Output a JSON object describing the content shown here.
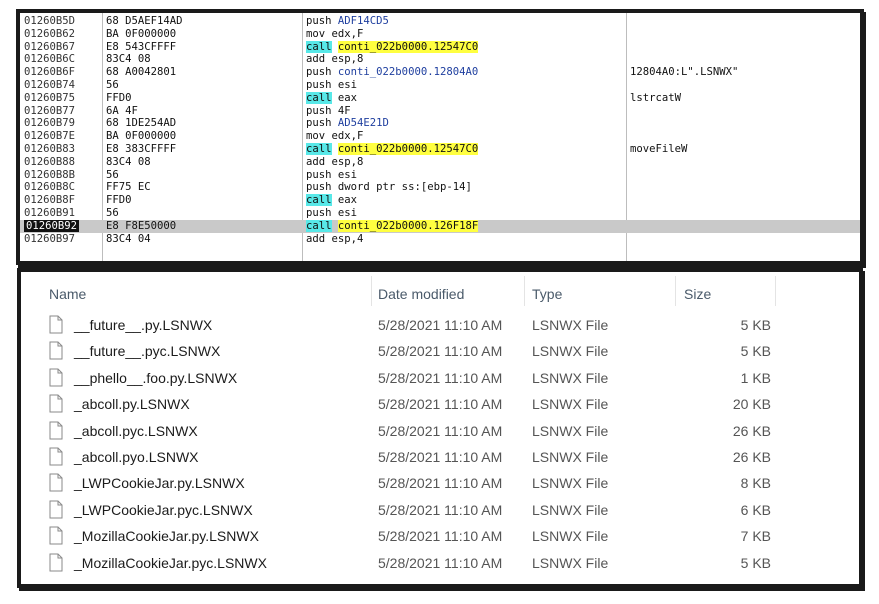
{
  "disassembly": {
    "rows": [
      {
        "addr": "01260B5D",
        "bytes": "68 D5AEF14AD",
        "mnem": "push",
        "op": "ADF14CD5",
        "cmt": ""
      },
      {
        "addr": "01260B62",
        "bytes": "BA 0F000000",
        "mnem": "mov",
        "op": "edx,F",
        "cmt": ""
      },
      {
        "addr": "01260B67",
        "bytes": "E8 543CFFFF",
        "mnem": "call",
        "op": "conti_022b0000.12547C0",
        "cmt": ""
      },
      {
        "addr": "01260B6C",
        "bytes": "83C4 08",
        "mnem": "add",
        "op": "esp,8",
        "cmt": ""
      },
      {
        "addr": "01260B6F",
        "bytes": "68 A0042801",
        "mnem": "push",
        "op": "conti_022b0000.12804A0",
        "cmt": "12804A0:L\".LSNWX\""
      },
      {
        "addr": "01260B74",
        "bytes": "56",
        "mnem": "push",
        "op": "esi",
        "cmt": ""
      },
      {
        "addr": "01260B75",
        "bytes": "FFD0",
        "mnem": "call",
        "op": "eax",
        "cmt": "lstrcatW"
      },
      {
        "addr": "01260B77",
        "bytes": "6A 4F",
        "mnem": "push",
        "op": "4F",
        "cmt": ""
      },
      {
        "addr": "01260B79",
        "bytes": "68 1DE254AD",
        "mnem": "push",
        "op": "AD54E21D",
        "cmt": ""
      },
      {
        "addr": "01260B7E",
        "bytes": "BA 0F000000",
        "mnem": "mov",
        "op": "edx,F",
        "cmt": ""
      },
      {
        "addr": "01260B83",
        "bytes": "E8 383CFFFF",
        "mnem": "call",
        "op": "conti_022b0000.12547C0",
        "cmt": "moveFileW"
      },
      {
        "addr": "01260B88",
        "bytes": "83C4 08",
        "mnem": "add",
        "op": "esp,8",
        "cmt": ""
      },
      {
        "addr": "01260B8B",
        "bytes": "56",
        "mnem": "push",
        "op": "esi",
        "cmt": ""
      },
      {
        "addr": "01260B8C",
        "bytes": "FF75 EC",
        "mnem": "push",
        "op": "dword ptr ss:[ebp-14]",
        "cmt": ""
      },
      {
        "addr": "01260B8F",
        "bytes": "FFD0",
        "mnem": "call",
        "op": "eax",
        "cmt": ""
      },
      {
        "addr": "01260B91",
        "bytes": "56",
        "mnem": "push",
        "op": "esi",
        "cmt": ""
      },
      {
        "addr": "01260B92",
        "bytes": "E8 F8E50000",
        "mnem": "call",
        "op": "conti_022b0000.126F18F",
        "cmt": ""
      },
      {
        "addr": "01260B97",
        "bytes": "83C4 04",
        "mnem": "add",
        "op": "esp,4",
        "cmt": ""
      }
    ],
    "selected_addr": "01260B92"
  },
  "explorer": {
    "columns": {
      "name": "Name",
      "date": "Date modified",
      "type": "Type",
      "size": "Size"
    },
    "files": [
      {
        "name": "__future__.py.LSNWX",
        "date": "5/28/2021 11:10 AM",
        "type": "LSNWX File",
        "size": "5 KB"
      },
      {
        "name": "__future__.pyc.LSNWX",
        "date": "5/28/2021 11:10 AM",
        "type": "LSNWX File",
        "size": "5 KB"
      },
      {
        "name": "__phello__.foo.py.LSNWX",
        "date": "5/28/2021 11:10 AM",
        "type": "LSNWX File",
        "size": "1 KB"
      },
      {
        "name": "_abcoll.py.LSNWX",
        "date": "5/28/2021 11:10 AM",
        "type": "LSNWX File",
        "size": "20 KB"
      },
      {
        "name": "_abcoll.pyc.LSNWX",
        "date": "5/28/2021 11:10 AM",
        "type": "LSNWX File",
        "size": "26 KB"
      },
      {
        "name": "_abcoll.pyo.LSNWX",
        "date": "5/28/2021 11:10 AM",
        "type": "LSNWX File",
        "size": "26 KB"
      },
      {
        "name": "_LWPCookieJar.py.LSNWX",
        "date": "5/28/2021 11:10 AM",
        "type": "LSNWX File",
        "size": "8 KB"
      },
      {
        "name": "_LWPCookieJar.pyc.LSNWX",
        "date": "5/28/2021 11:10 AM",
        "type": "LSNWX File",
        "size": "6 KB"
      },
      {
        "name": "_MozillaCookieJar.py.LSNWX",
        "date": "5/28/2021 11:10 AM",
        "type": "LSNWX File",
        "size": "7 KB"
      },
      {
        "name": "_MozillaCookieJar.pyc.LSNWX",
        "date": "5/28/2021 11:10 AM",
        "type": "LSNWX File",
        "size": "5 KB"
      }
    ]
  },
  "colors": {
    "call_highlight": "#58e8e8",
    "target_highlight": "#ffff40",
    "selected_row": "#c9c9c9",
    "header_text": "#4a5a6a"
  },
  "icons": {
    "file": "file-icon"
  }
}
